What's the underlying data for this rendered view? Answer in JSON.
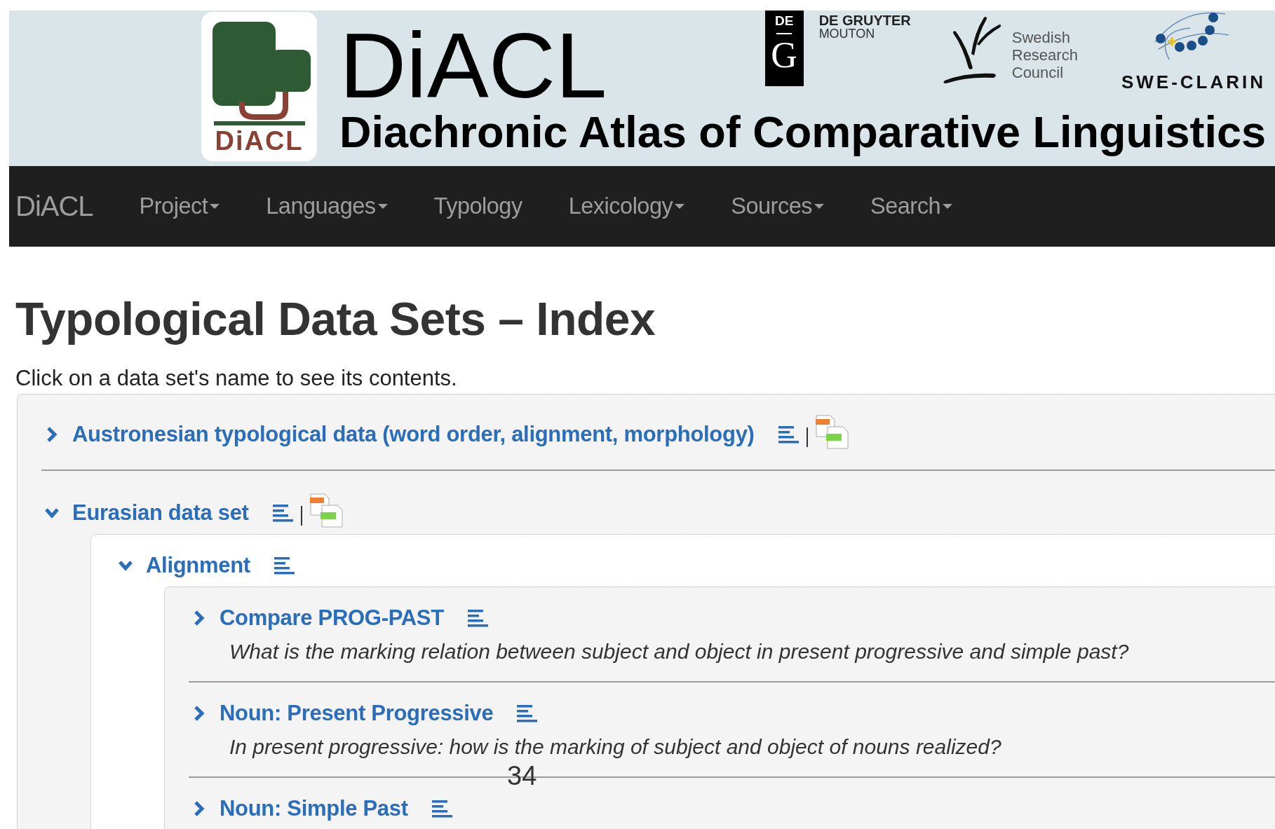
{
  "header": {
    "logo_text": "DiACL",
    "title": "DiACL",
    "subtitle": "Diachronic Atlas of Comparative Linguistics",
    "partners": [
      {
        "kind": "publisher",
        "badge_top": "DE",
        "badge_bottom": "G",
        "lines": [
          "DE GRUYTER",
          "MOUTON"
        ]
      },
      {
        "kind": "council",
        "lines": [
          "Swedish",
          "Research",
          "Council"
        ]
      },
      {
        "kind": "clarin",
        "lines": [
          "SWE-CLARIN"
        ]
      }
    ]
  },
  "nav": {
    "brand": "DiACL",
    "items": [
      {
        "label": "Project",
        "dropdown": true
      },
      {
        "label": "Languages",
        "dropdown": true
      },
      {
        "label": "Typology",
        "dropdown": false
      },
      {
        "label": "Lexicology",
        "dropdown": true
      },
      {
        "label": "Sources",
        "dropdown": true
      },
      {
        "label": "Search",
        "dropdown": true
      }
    ]
  },
  "page": {
    "heading": "Typological Data Sets – Index",
    "intro": "Click on a data set's name to see its contents.",
    "datasets": [
      {
        "title": "Austronesian typological data (word order, alignment, morphology)",
        "expanded": false,
        "downloads": true
      },
      {
        "title": "Eurasian data set",
        "expanded": true,
        "downloads": true,
        "children": [
          {
            "title": "Alignment",
            "expanded": true,
            "children": [
              {
                "title": "Compare PROG-PAST",
                "expanded": false,
                "description": "What is the marking relation between subject and object in present progressive and simple past?"
              },
              {
                "title": "Noun: Present Progressive",
                "expanded": false,
                "description": "In present progressive: how is the marking of subject and object of nouns realized?"
              },
              {
                "title": "Noun: Simple Past",
                "expanded": false
              }
            ]
          }
        ]
      }
    ],
    "page_number": "34"
  }
}
